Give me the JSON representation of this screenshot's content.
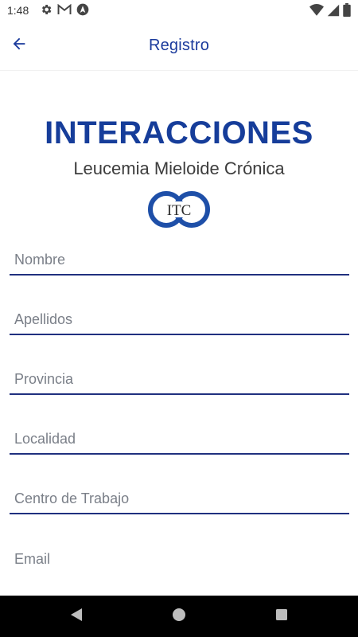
{
  "status_bar": {
    "time": "1:48",
    "left_icons": [
      "gear-icon",
      "gmail-icon",
      "nav-app-icon"
    ],
    "right_icons": [
      "wifi-icon",
      "signal-icon",
      "battery-icon"
    ]
  },
  "app_bar": {
    "title": "Registro",
    "back_icon": "arrow-left-icon",
    "accent_color": "#1a3a9c"
  },
  "header": {
    "title": "INTERACCIONES",
    "subtitle": "Leucemia Mieloide Crónica",
    "logo_text": "ITC"
  },
  "form": {
    "fields": [
      {
        "placeholder": "Nombre",
        "value": ""
      },
      {
        "placeholder": "Apellidos",
        "value": ""
      },
      {
        "placeholder": "Provincia",
        "value": ""
      },
      {
        "placeholder": "Localidad",
        "value": ""
      },
      {
        "placeholder": "Centro de Trabajo",
        "value": ""
      },
      {
        "placeholder": "Email",
        "value": ""
      }
    ]
  },
  "nav_bar": {
    "buttons": [
      "back-triangle-icon",
      "home-circle-icon",
      "recents-square-icon"
    ]
  }
}
